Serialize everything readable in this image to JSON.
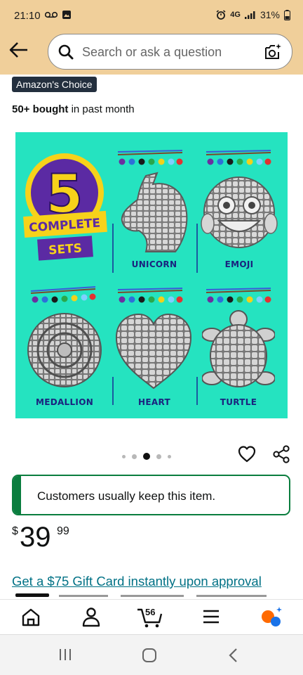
{
  "status_bar": {
    "time": "21:10",
    "network": "4G",
    "battery": "31%"
  },
  "header": {
    "search_placeholder": "Search or ask a question"
  },
  "badges": {
    "choice": "Amazon's Choice",
    "bought_bold": "50+ bought",
    "bought_rest": " in past month"
  },
  "product_image": {
    "badge_number": "5",
    "badge_line1": "COMPLETE",
    "badge_line2": "SETS",
    "labels": [
      "UNICORN",
      "EMOJI",
      "MEDALLION",
      "HEART",
      "TURTLE"
    ],
    "background_color": "#25e3c0"
  },
  "carousel": {
    "count": 5,
    "active_index": 2
  },
  "keep_banner": {
    "text": "Customers usually keep this item."
  },
  "price": {
    "currency": "$",
    "whole": "39",
    "fraction": "99"
  },
  "gift_link": "Get a $75 Gift Card instantly upon approval",
  "bottom_nav": {
    "items": [
      "home-icon",
      "account-icon",
      "cart-icon",
      "menu-icon",
      "rufus-icon"
    ],
    "cart_count": "56"
  },
  "colors": {
    "header_bg": "#f0cf9a",
    "link": "#007185",
    "keep_green": "#0a7d3e",
    "badge_dark": "#232f3e"
  }
}
